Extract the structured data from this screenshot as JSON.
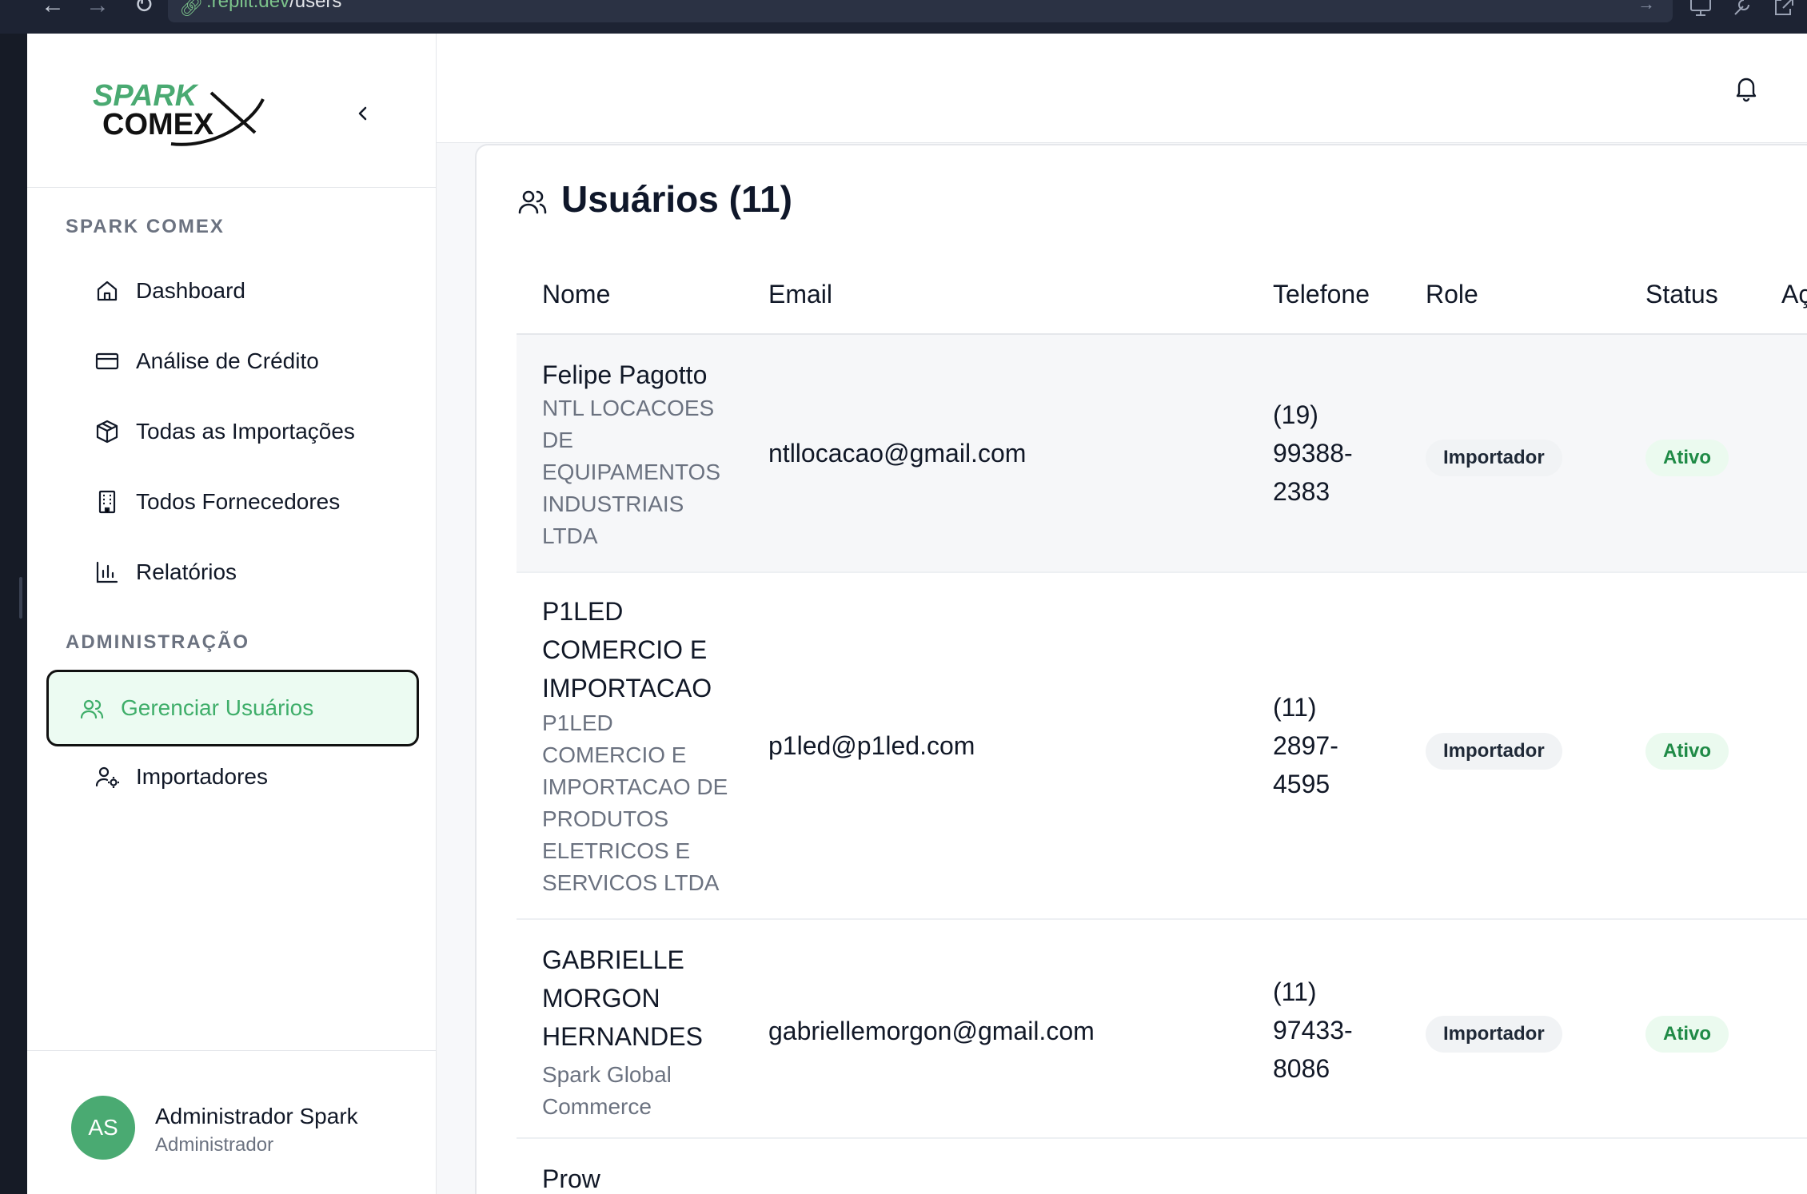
{
  "browser": {
    "url_host": ".replit.dev",
    "url_path": "/users"
  },
  "sidebar": {
    "logo_line1": "SPARK",
    "logo_line2": "COMEX",
    "section_main": "SPARK COMEX",
    "section_admin": "ADMINISTRAÇÃO",
    "items": [
      {
        "label": "Dashboard",
        "icon": "home-icon"
      },
      {
        "label": "Análise de Crédito",
        "icon": "credit-card-icon"
      },
      {
        "label": "Todas as Importações",
        "icon": "package-icon"
      },
      {
        "label": "Todos Fornecedores",
        "icon": "building-icon"
      },
      {
        "label": "Relatórios",
        "icon": "bar-chart-icon"
      }
    ],
    "admin_items": [
      {
        "label": "Gerenciar Usuários",
        "icon": "users-icon",
        "active": true
      },
      {
        "label": "Importadores",
        "icon": "user-cog-icon"
      }
    ],
    "profile": {
      "initials": "AS",
      "name": "Administrador Spark",
      "role": "Administrador"
    }
  },
  "page": {
    "title": "Usuários (11)"
  },
  "table": {
    "columns": [
      "Nome",
      "Email",
      "Telefone",
      "Role",
      "Status",
      "Aç"
    ],
    "rows": [
      {
        "name": "Felipe Pagotto",
        "company": "NTL LOCACOES DE EQUIPAMENTOS INDUSTRIAIS LTDA",
        "email": "ntllocacao@gmail.com",
        "phone": "(19) 99388-2383",
        "role": "Importador",
        "status": "Ativo"
      },
      {
        "name": "P1LED COMERCIO E IMPORTACAO",
        "company": "P1LED COMERCIO E IMPORTACAO DE PRODUTOS ELETRICOS E SERVICOS LTDA",
        "email": "p1led@p1led.com",
        "phone": "(11) 2897-4595",
        "role": "Importador",
        "status": "Ativo"
      },
      {
        "name": "GABRIELLE MORGON HERNANDES",
        "company": "Spark Global Commerce",
        "email": "gabriellemorgon@gmail.com",
        "phone": "(11) 97433-8086",
        "role": "Importador",
        "status": "Ativo"
      },
      {
        "name": "Prow",
        "company": "",
        "email": "",
        "phone": "",
        "role": "",
        "status": ""
      }
    ]
  },
  "colors": {
    "accent": "#3fae6a",
    "status_active_bg": "#ebfaef",
    "status_active_text": "#1f8a46"
  }
}
